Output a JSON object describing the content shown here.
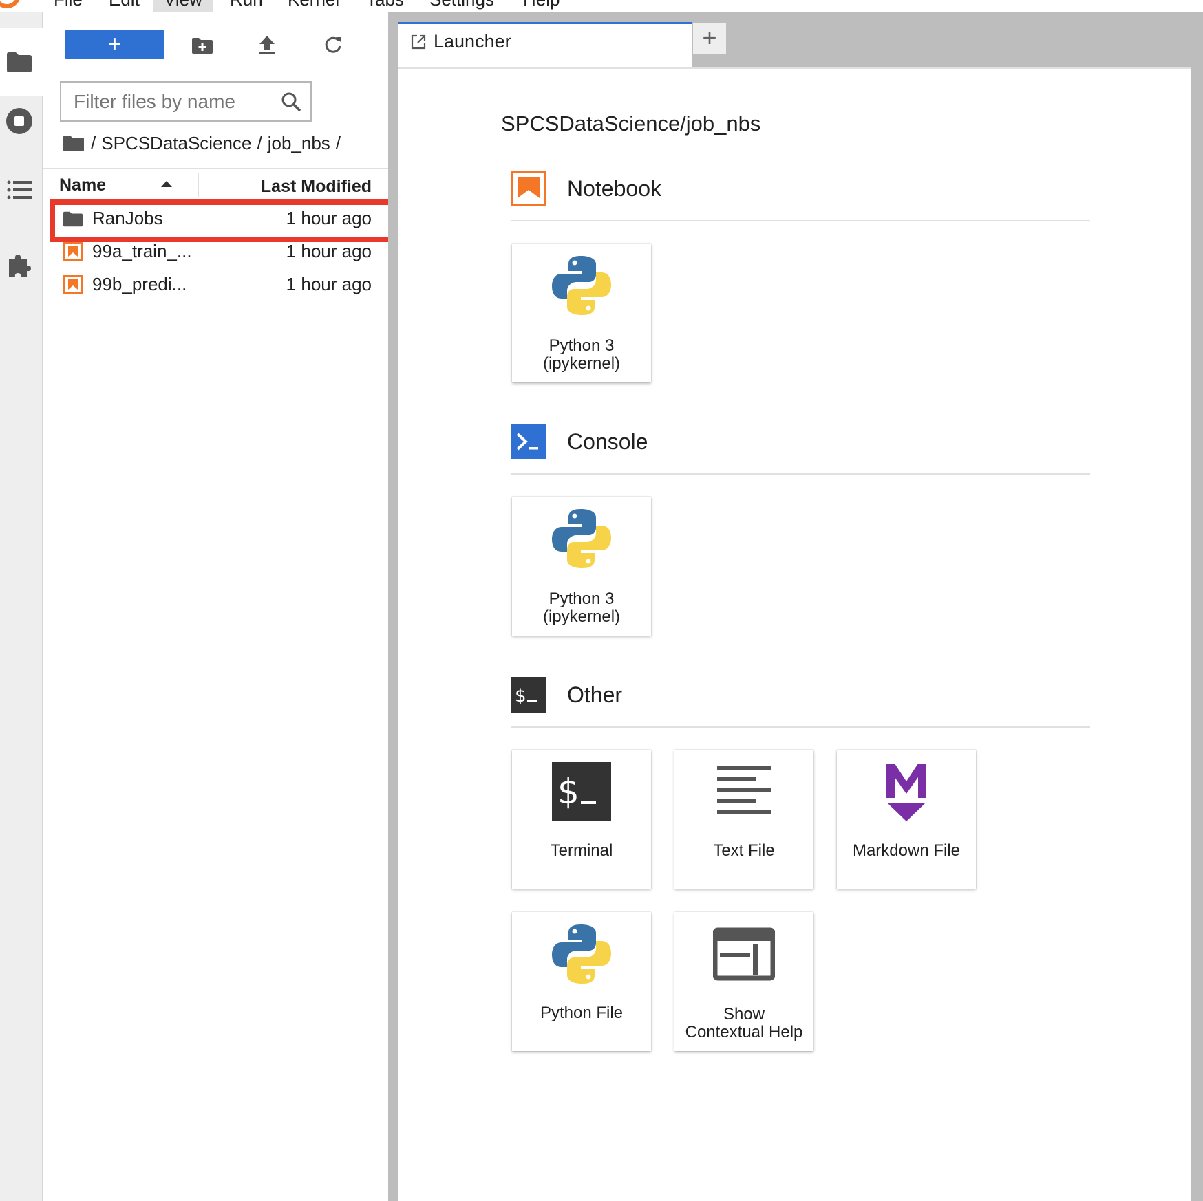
{
  "menubar": {
    "items": [
      {
        "label": "File"
      },
      {
        "label": "Edit"
      },
      {
        "label": "View"
      },
      {
        "label": "Run"
      },
      {
        "label": "Kernel"
      },
      {
        "label": "Tabs"
      },
      {
        "label": "Settings"
      },
      {
        "label": "Help"
      }
    ]
  },
  "file_browser": {
    "new_button_label": "+",
    "filter_placeholder": "Filter files by name",
    "breadcrumb": {
      "separator": "/",
      "parts": [
        "SPCSDataScience",
        "job_nbs"
      ]
    },
    "columns": {
      "name": "Name",
      "last_modified": "Last Modified"
    },
    "files": [
      {
        "name": "RanJobs",
        "modified": "1 hour ago",
        "type": "folder"
      },
      {
        "name": "99a_train_...",
        "modified": "1 hour ago",
        "type": "notebook"
      },
      {
        "name": "99b_predi...",
        "modified": "1 hour ago",
        "type": "notebook"
      }
    ]
  },
  "tabs": {
    "launcher_label": "Launcher",
    "add_label": "+"
  },
  "launcher": {
    "cwd": "SPCSDataScience/job_nbs",
    "sections": {
      "notebook": {
        "title": "Notebook",
        "cards": [
          {
            "label_line1": "Python 3",
            "label_line2": "(ipykernel)"
          }
        ]
      },
      "console": {
        "title": "Console",
        "cards": [
          {
            "label_line1": "Python 3",
            "label_line2": "(ipykernel)"
          }
        ]
      },
      "other": {
        "title": "Other",
        "cards": [
          {
            "label": "Terminal"
          },
          {
            "label": "Text File"
          },
          {
            "label": "Markdown File"
          },
          {
            "label": "Python File"
          },
          {
            "label_line1": "Show",
            "label_line2": "Contextual Help"
          }
        ]
      }
    }
  },
  "colors": {
    "accent_blue": "#2f70d3",
    "notebook_orange": "#f37726",
    "highlight_red": "#e8392a",
    "markdown_purple": "#7b2fa6",
    "terminal_dark": "#333333"
  }
}
